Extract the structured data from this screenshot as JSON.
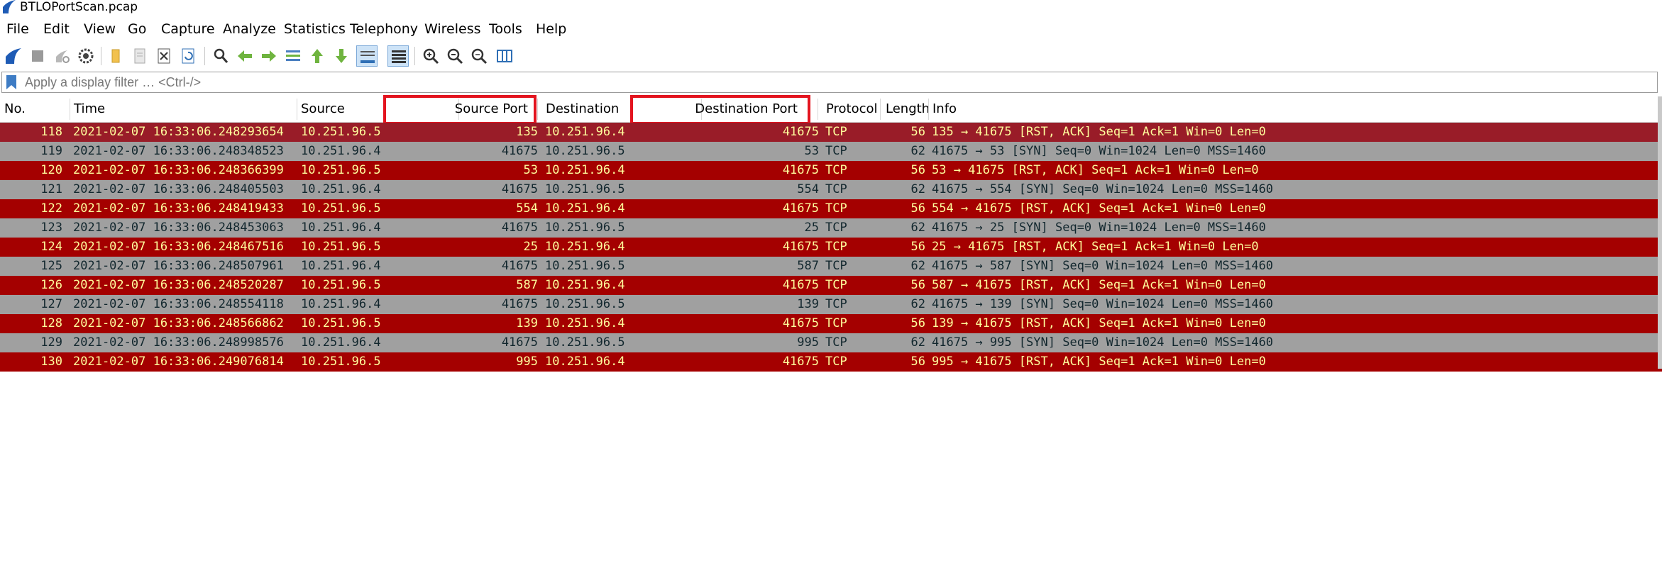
{
  "window": {
    "title": "BTLOPortScan.pcap"
  },
  "menu": [
    "File",
    "Edit",
    "View",
    "Go",
    "Capture",
    "Analyze",
    "Statistics",
    "Telephony",
    "Wireless",
    "Tools",
    "Help"
  ],
  "toolbar_icons": [
    "shark-fin-start-icon",
    "stop-icon",
    "restart-icon",
    "options-gear-icon",
    "open-folder-icon",
    "file-icon",
    "close-file-icon",
    "reload-icon",
    "find-icon",
    "go-back-icon",
    "go-forward-icon",
    "go-to-packet-icon",
    "go-first-icon",
    "go-last-icon",
    "autoscroll-icon",
    "colorize-icon",
    "zoom-in-icon",
    "zoom-out-icon",
    "normal-size-icon",
    "resize-columns-icon"
  ],
  "filter": {
    "placeholder": "Apply a display filter … <Ctrl-/>",
    "value": ""
  },
  "columns": [
    "No.",
    "Time",
    "Source",
    "Source Port",
    "Destination",
    "Destination Port",
    "Protocol",
    "Length",
    "Info"
  ],
  "colors": {
    "rst_bg": "#a40000",
    "rst_fg": "#fffc9c",
    "syn_bg": "#a0a0a0",
    "syn_fg": "#12272e",
    "highlight": "#e3141f"
  },
  "packets": [
    {
      "no": "118",
      "time": "2021-02-07 16:33:06.248293654",
      "src": "10.251.96.5",
      "sport": "135",
      "dst": "10.251.96.4",
      "dport": "41675",
      "proto": "TCP",
      "len": "56",
      "info": "135 → 41675 [RST, ACK] Seq=1 Ack=1 Win=0 Len=0",
      "kind": "rst"
    },
    {
      "no": "119",
      "time": "2021-02-07 16:33:06.248348523",
      "src": "10.251.96.4",
      "sport": "41675",
      "dst": "10.251.96.5",
      "dport": "53",
      "proto": "TCP",
      "len": "62",
      "info": "41675 → 53 [SYN] Seq=0 Win=1024 Len=0 MSS=1460",
      "kind": "syn"
    },
    {
      "no": "120",
      "time": "2021-02-07 16:33:06.248366399",
      "src": "10.251.96.5",
      "sport": "53",
      "dst": "10.251.96.4",
      "dport": "41675",
      "proto": "TCP",
      "len": "56",
      "info": "53 → 41675 [RST, ACK] Seq=1 Ack=1 Win=0 Len=0",
      "kind": "rst"
    },
    {
      "no": "121",
      "time": "2021-02-07 16:33:06.248405503",
      "src": "10.251.96.4",
      "sport": "41675",
      "dst": "10.251.96.5",
      "dport": "554",
      "proto": "TCP",
      "len": "62",
      "info": "41675 → 554 [SYN] Seq=0 Win=1024 Len=0 MSS=1460",
      "kind": "syn"
    },
    {
      "no": "122",
      "time": "2021-02-07 16:33:06.248419433",
      "src": "10.251.96.5",
      "sport": "554",
      "dst": "10.251.96.4",
      "dport": "41675",
      "proto": "TCP",
      "len": "56",
      "info": "554 → 41675 [RST, ACK] Seq=1 Ack=1 Win=0 Len=0",
      "kind": "rst"
    },
    {
      "no": "123",
      "time": "2021-02-07 16:33:06.248453063",
      "src": "10.251.96.4",
      "sport": "41675",
      "dst": "10.251.96.5",
      "dport": "25",
      "proto": "TCP",
      "len": "62",
      "info": "41675 → 25 [SYN] Seq=0 Win=1024 Len=0 MSS=1460",
      "kind": "syn"
    },
    {
      "no": "124",
      "time": "2021-02-07 16:33:06.248467516",
      "src": "10.251.96.5",
      "sport": "25",
      "dst": "10.251.96.4",
      "dport": "41675",
      "proto": "TCP",
      "len": "56",
      "info": "25 → 41675 [RST, ACK] Seq=1 Ack=1 Win=0 Len=0",
      "kind": "rst"
    },
    {
      "no": "125",
      "time": "2021-02-07 16:33:06.248507961",
      "src": "10.251.96.4",
      "sport": "41675",
      "dst": "10.251.96.5",
      "dport": "587",
      "proto": "TCP",
      "len": "62",
      "info": "41675 → 587 [SYN] Seq=0 Win=1024 Len=0 MSS=1460",
      "kind": "syn"
    },
    {
      "no": "126",
      "time": "2021-02-07 16:33:06.248520287",
      "src": "10.251.96.5",
      "sport": "587",
      "dst": "10.251.96.4",
      "dport": "41675",
      "proto": "TCP",
      "len": "56",
      "info": "587 → 41675 [RST, ACK] Seq=1 Ack=1 Win=0 Len=0",
      "kind": "rst"
    },
    {
      "no": "127",
      "time": "2021-02-07 16:33:06.248554118",
      "src": "10.251.96.4",
      "sport": "41675",
      "dst": "10.251.96.5",
      "dport": "139",
      "proto": "TCP",
      "len": "62",
      "info": "41675 → 139 [SYN] Seq=0 Win=1024 Len=0 MSS=1460",
      "kind": "syn"
    },
    {
      "no": "128",
      "time": "2021-02-07 16:33:06.248566862",
      "src": "10.251.96.5",
      "sport": "139",
      "dst": "10.251.96.4",
      "dport": "41675",
      "proto": "TCP",
      "len": "56",
      "info": "139 → 41675 [RST, ACK] Seq=1 Ack=1 Win=0 Len=0",
      "kind": "rst"
    },
    {
      "no": "129",
      "time": "2021-02-07 16:33:06.248998576",
      "src": "10.251.96.4",
      "sport": "41675",
      "dst": "10.251.96.5",
      "dport": "995",
      "proto": "TCP",
      "len": "62",
      "info": "41675 → 995 [SYN] Seq=0 Win=1024 Len=0 MSS=1460",
      "kind": "syn"
    },
    {
      "no": "130",
      "time": "2021-02-07 16:33:06.249076814",
      "src": "10.251.96.5",
      "sport": "995",
      "dst": "10.251.96.4",
      "dport": "41675",
      "proto": "TCP",
      "len": "56",
      "info": "995 → 41675 [RST, ACK] Seq=1 Ack=1 Win=0 Len=0",
      "kind": "rst"
    }
  ]
}
